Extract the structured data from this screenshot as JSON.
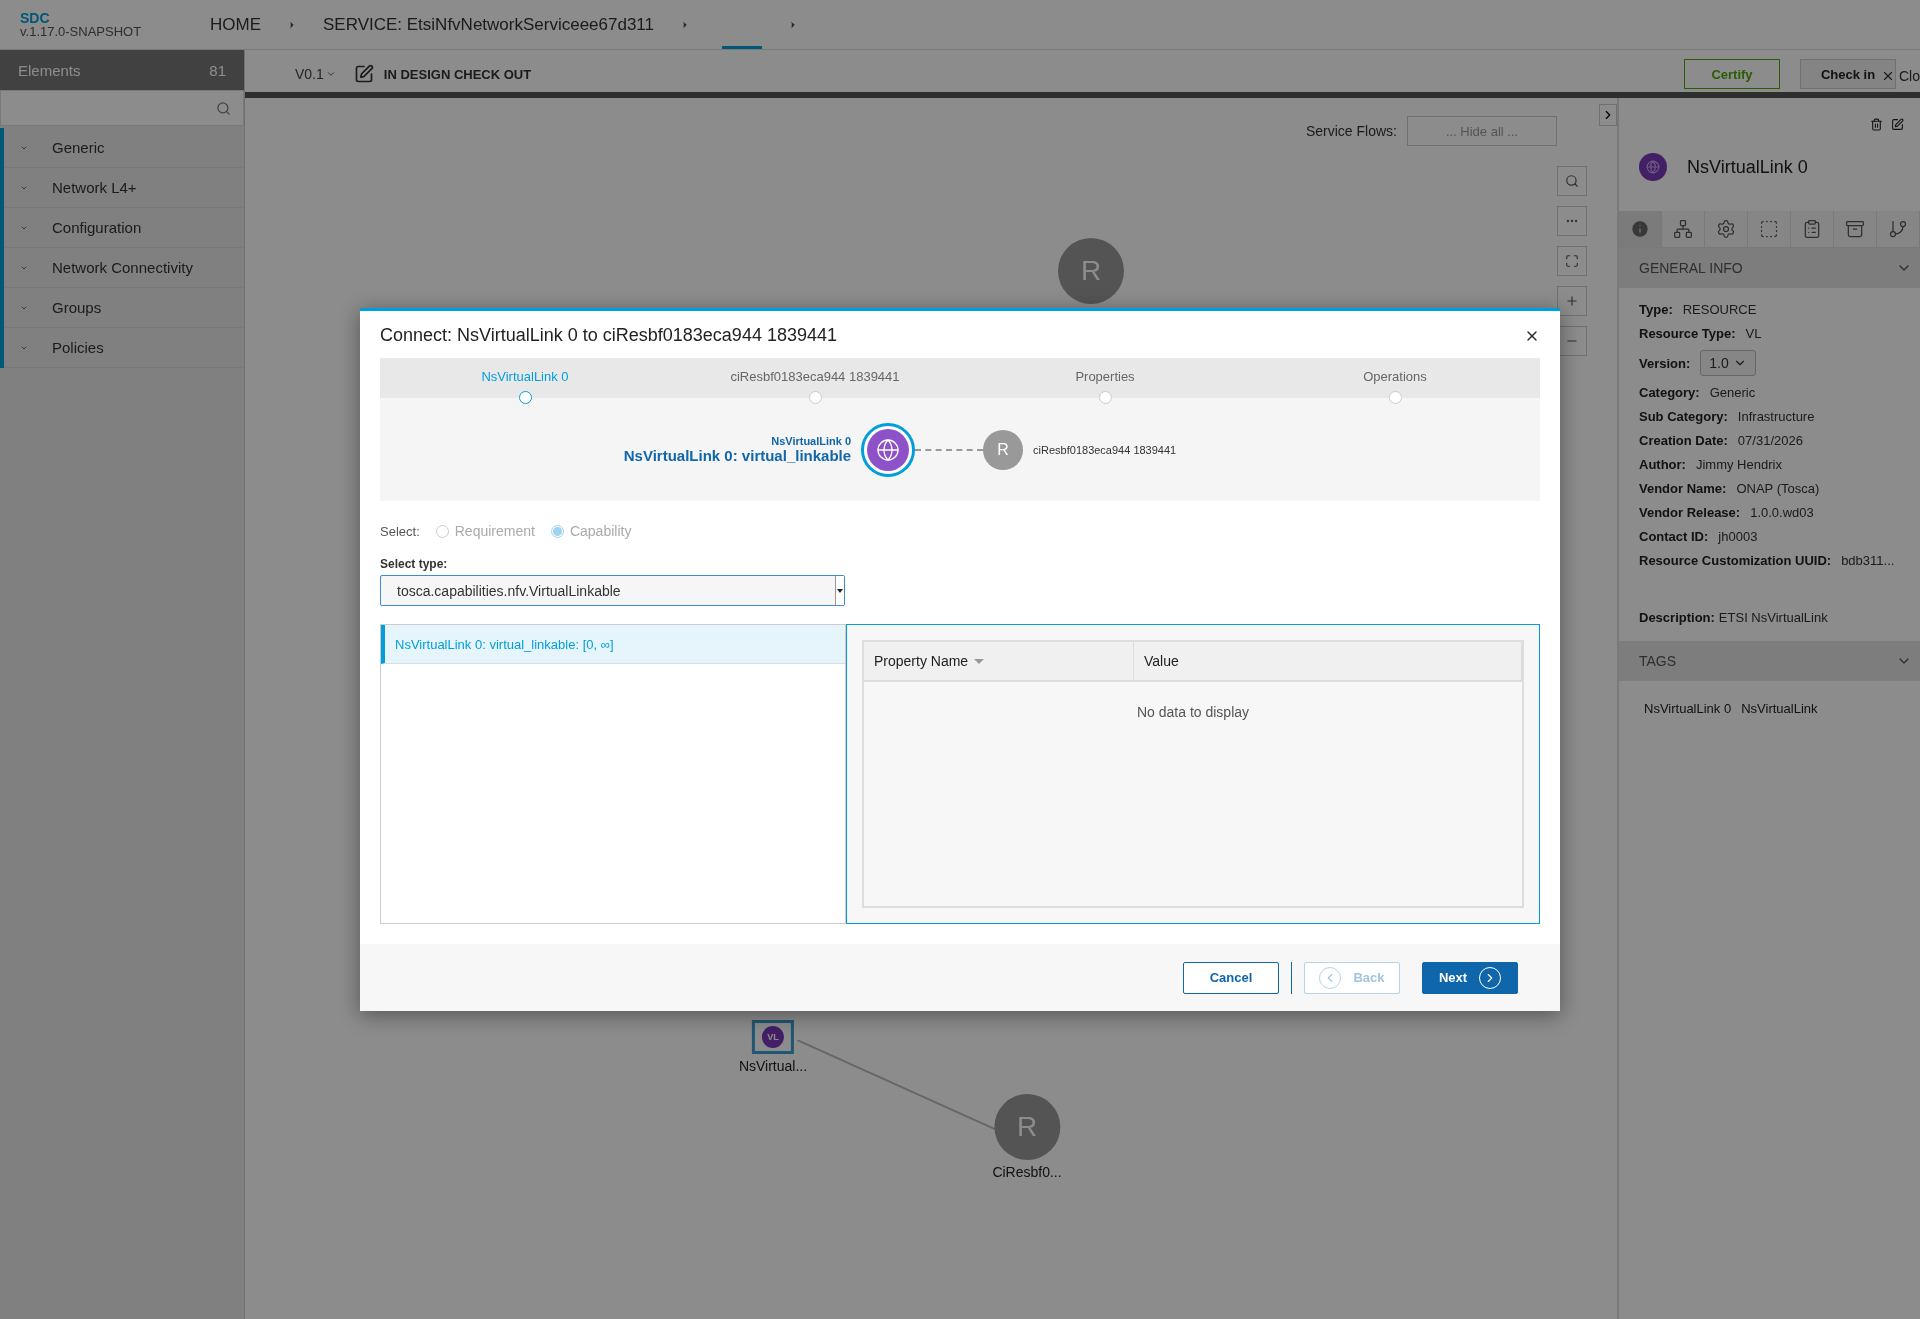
{
  "top_bar": {
    "brand": "SDC",
    "version": "v.1.17.0-SNAPSHOT",
    "breadcrumbs": [
      {
        "label": "HOME"
      },
      {
        "label": "SERVICE: EtsiNfvNetworkServiceee67d311"
      }
    ]
  },
  "sidebar": {
    "title": "Elements",
    "count": "81",
    "items": [
      {
        "label": "Generic"
      },
      {
        "label": "Network L4+"
      },
      {
        "label": "Configuration"
      },
      {
        "label": "Network Connectivity"
      },
      {
        "label": "Groups"
      },
      {
        "label": "Policies"
      }
    ]
  },
  "toolbar": {
    "version": "V0.1",
    "status": "IN DESIGN CHECK OUT",
    "certify": "Certify",
    "check_in": "Check in",
    "close": "Clo"
  },
  "canvas": {
    "service_flows_label": "Service Flows:",
    "service_flows_value": "... Hide all ...",
    "nodes": [
      {
        "kind": "resource",
        "letter": "R"
      },
      {
        "kind": "vl",
        "letter": "VL",
        "label": "NsVirtual..."
      },
      {
        "kind": "resource",
        "letter": "R",
        "label": "CiResbf0..."
      }
    ]
  },
  "right_panel": {
    "title": "NsVirtualLink 0",
    "tabs": [
      {
        "kind": "info",
        "selected": true
      },
      {
        "kind": "composition",
        "selected": false
      },
      {
        "kind": "settings",
        "selected": false
      },
      {
        "kind": "details",
        "selected": false
      },
      {
        "kind": "notes",
        "selected": false
      },
      {
        "kind": "archive",
        "selected": false
      },
      {
        "kind": "paths",
        "selected": false
      }
    ],
    "general_info": {
      "heading": "GENERAL INFO",
      "fields": [
        {
          "label": "Type:",
          "value": "RESOURCE"
        },
        {
          "label": "Resource Type:",
          "value": "VL"
        },
        {
          "label": "Version:",
          "value": "1.0",
          "kind": "select"
        },
        {
          "label": "Category:",
          "value": "Generic"
        },
        {
          "label": "Sub Category:",
          "value": "Infrastructure"
        },
        {
          "label": "Creation Date:",
          "value": "07/31/2026"
        },
        {
          "label": "Author:",
          "value": "Jimmy Hendrix"
        },
        {
          "label": "Vendor Name:",
          "value": "ONAP (Tosca)"
        },
        {
          "label": "Vendor Release:",
          "value": "1.0.0.wd03"
        },
        {
          "label": "Contact ID:",
          "value": "jh0003"
        },
        {
          "label": "Resource Customization UUID:",
          "value": "bdb311..."
        }
      ],
      "description_label": "Description:",
      "description": "ETSI NsVirtualLink"
    },
    "tags": {
      "heading": "TAGS",
      "items": [
        "NsVirtualLink 0",
        "NsVirtualLink"
      ]
    }
  },
  "dialog": {
    "title": "Connect: NsVirtualLink 0 to ciResbf0183eca944 1839441",
    "steps": [
      {
        "label": "NsVirtualLink 0",
        "selected": true
      },
      {
        "label": "ciResbf0183eca944 1839441",
        "selected": false
      },
      {
        "label": "Properties",
        "selected": false
      },
      {
        "label": "Operations",
        "selected": false
      }
    ],
    "preview": {
      "source_name": "NsVirtualLink 0",
      "source_capability": "NsVirtualLink 0: virtual_linkable",
      "target_letter": "R",
      "target_name": "ciResbf0183eca944 1839441"
    },
    "select_label": "Select:",
    "options": [
      {
        "label": "Requirement",
        "checked": false
      },
      {
        "label": "Capability",
        "checked": true
      }
    ],
    "type_label": "Select type:",
    "type_value": "tosca.capabilities.nfv.VirtualLinkable",
    "capabilities": [
      {
        "label": "NsVirtualLink 0: virtual_linkable: [0, ∞]",
        "selected": true
      }
    ],
    "table": {
      "columns": [
        "Property Name",
        "Value"
      ],
      "empty": "No data to display"
    },
    "buttons": {
      "cancel": "Cancel",
      "back": "Back",
      "next": "Next"
    }
  }
}
